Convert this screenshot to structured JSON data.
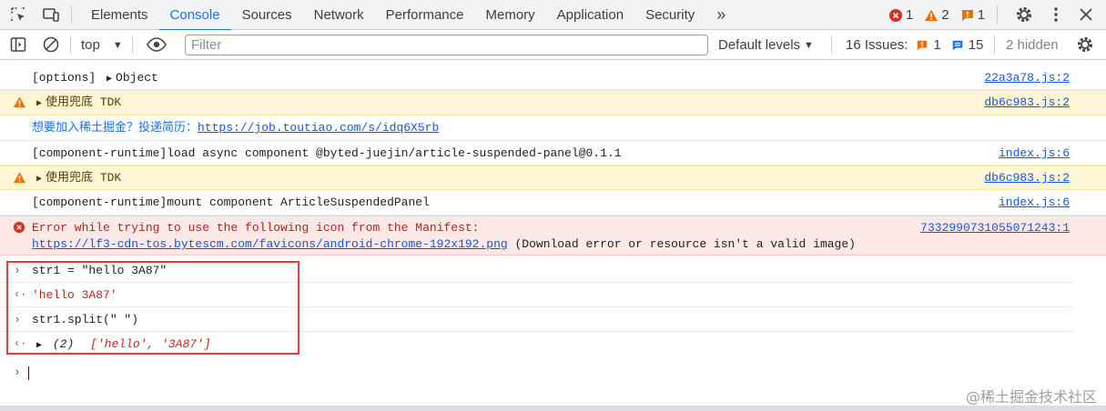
{
  "tabs": [
    "Elements",
    "Console",
    "Sources",
    "Network",
    "Performance",
    "Memory",
    "Application",
    "Security"
  ],
  "active_tab": "Console",
  "counters": {
    "errors": "1",
    "warnings": "2",
    "infos": "1"
  },
  "toolbar": {
    "context": "top",
    "filter_placeholder": "Filter",
    "levels": "Default levels",
    "issues_label": "16 Issues:",
    "issues_warn": "1",
    "issues_info": "15",
    "hidden": "2 hidden"
  },
  "logs": [
    {
      "text": "[options] ",
      "object": "Object",
      "source": "22a3a78.js:2"
    },
    {
      "text": "使用兜底 TDK",
      "source": "db6c983.js:2"
    },
    {
      "text": "想要加入稀土掘金？投递简历：",
      "link": "https://job.toutiao.com/s/idq6X5rb"
    },
    {
      "text": "[component-runtime]load async component @byted-juejin/article-suspended-panel@0.1.1",
      "source": "index.js:6"
    },
    {
      "text": "使用兜底 TDK",
      "source": "db6c983.js:2"
    },
    {
      "text": "[component-runtime]mount component ArticleSuspendedPanel",
      "source": "index.js:6"
    },
    {
      "text": "Error while trying to use the following icon from the Manifest:",
      "link": "https://lf3-cdn-tos.bytescm.com/favicons/android-chrome-192x192.png",
      "text2": " (Download error or resource isn't a valid image)",
      "source": "7332990731055071243:1"
    }
  ],
  "repl": [
    {
      "input": "str1 = \"hello 3A87\""
    },
    {
      "output": "'hello 3A87'"
    },
    {
      "input": "str1.split(\" \")"
    },
    {
      "output_count": "(2)",
      "output_array": "['hello', '3A87']"
    }
  ],
  "watermark": "@稀土掘金技术社区",
  "colors": {
    "accent": "#1a73e8",
    "error": "#d93025",
    "warning": "#e8710a",
    "highlight_box": "#e03c3c"
  }
}
